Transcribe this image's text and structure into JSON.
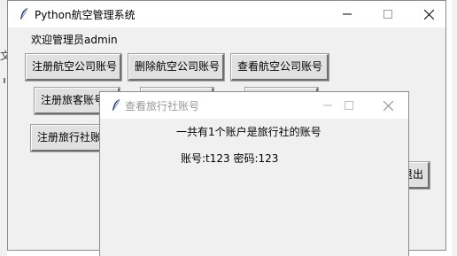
{
  "main_window": {
    "title": "Python航空管理系统",
    "welcome": "欢迎管理员admin",
    "buttons": {
      "register_airline": "注册航空公司账号",
      "delete_airline": "删除航空公司账号",
      "view_airline": "查看航空公司账号",
      "register_passenger": "注册旅客账号",
      "register_agency": "注册旅行社账号",
      "logout": "退出"
    }
  },
  "background": {
    "left_edge_char": "文"
  },
  "dialog": {
    "title": "查看旅行社账号",
    "summary": "一共有1个账户是旅行社的账号",
    "account_line": "账号:t123 密码:123"
  },
  "icons": {
    "app": "feather-icon",
    "minimize": "minimize-icon",
    "maximize": "maximize-icon",
    "close": "close-icon"
  }
}
